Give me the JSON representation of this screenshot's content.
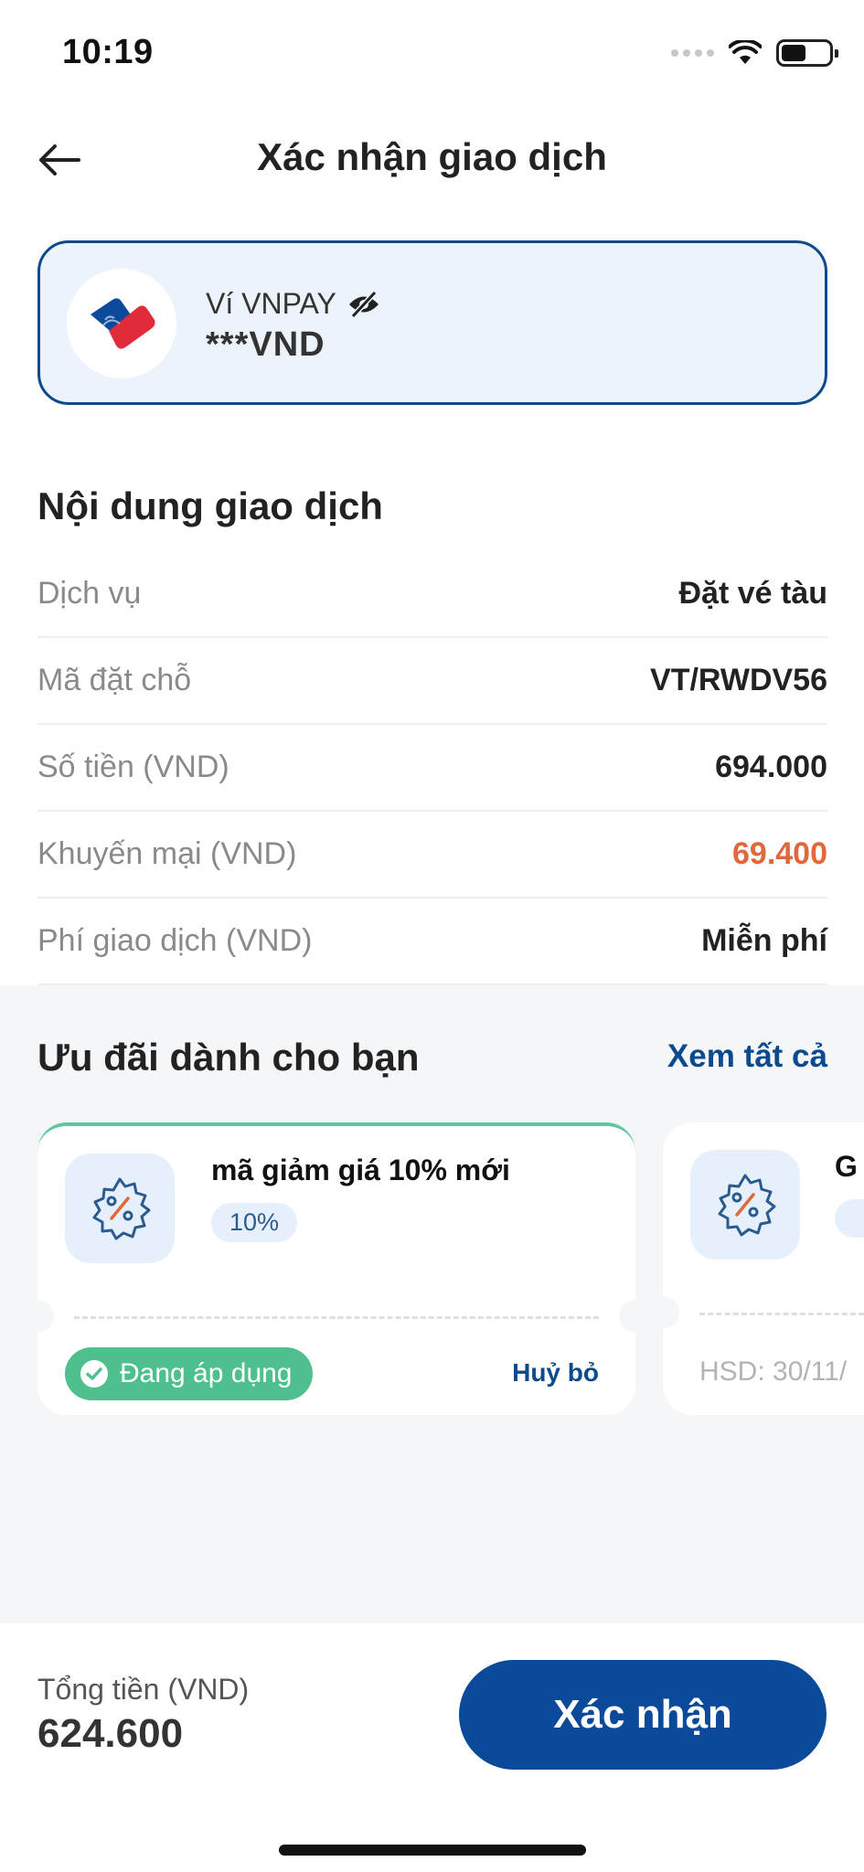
{
  "status_bar": {
    "time": "10:19"
  },
  "header": {
    "title": "Xác nhận giao dịch"
  },
  "wallet": {
    "name": "Ví VNPAY",
    "balance": "***VND"
  },
  "transaction": {
    "title": "Nội dung giao dịch",
    "rows": [
      {
        "label": "Dịch vụ",
        "value": "Đặt vé tàu"
      },
      {
        "label": "Mã đặt chỗ",
        "value": "VT/RWDV56"
      },
      {
        "label": "Số tiền (VND)",
        "value": "694.000"
      },
      {
        "label": "Khuyến mại (VND)",
        "value": "69.400"
      },
      {
        "label": "Phí giao dịch (VND)",
        "value": "Miễn phí"
      }
    ]
  },
  "offers": {
    "title": "Ưu đãi dành cho bạn",
    "see_all": "Xem tất cả",
    "active_voucher": {
      "title": "mã giảm giá 10% mới",
      "tag": "10%",
      "status": "Đang áp dụng",
      "cancel": "Huỷ bỏ"
    },
    "next_voucher": {
      "title_partial": "G",
      "expiry_partial": "HSD:  30/11/"
    }
  },
  "footer": {
    "total_label": "Tổng tiền (VND)",
    "total_value": "624.600",
    "confirm": "Xác nhận"
  },
  "colors": {
    "primary": "#0b4a9a",
    "discount": "#e0683a",
    "success": "#4fc08d",
    "card_bg": "#edf3fb"
  }
}
